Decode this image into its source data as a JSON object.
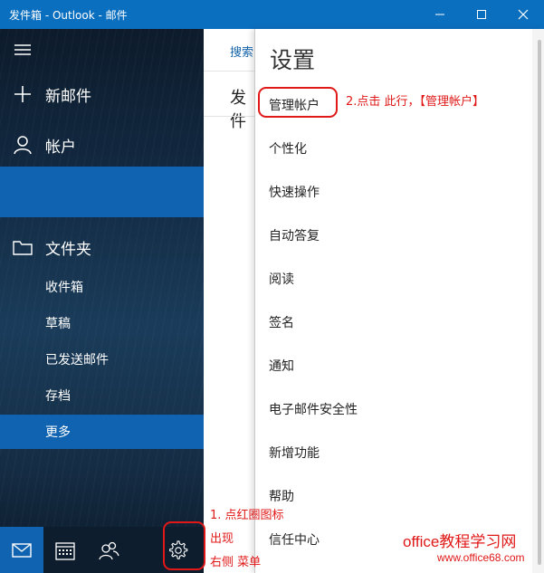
{
  "window": {
    "title": "发件箱 - Outlook - 邮件"
  },
  "nav": {
    "new_mail": "新邮件",
    "account": "帐户",
    "folders_label": "文件夹",
    "folders": [
      "收件箱",
      "草稿",
      "已发送邮件",
      "存档",
      "更多"
    ],
    "selected_folder": "更多"
  },
  "mid": {
    "search": "搜索",
    "header": "发件"
  },
  "settings": {
    "title": "设置",
    "items": [
      "管理帐户",
      "个性化",
      "快速操作",
      "自动答复",
      "阅读",
      "签名",
      "通知",
      "电子邮件安全性",
      "新增功能",
      "帮助",
      "信任中心"
    ]
  },
  "annotations": {
    "step2": "2.点击 此行，【管理帐户】",
    "step1_line1": "1. 点红圈图标",
    "step1_line2": "出现",
    "step1_line3": "右侧 菜单"
  },
  "watermark": {
    "line1": "office教程学习网",
    "line2": "www.office68.com"
  },
  "colors": {
    "accent": "#0f63b0",
    "annotation": "#e01818"
  }
}
